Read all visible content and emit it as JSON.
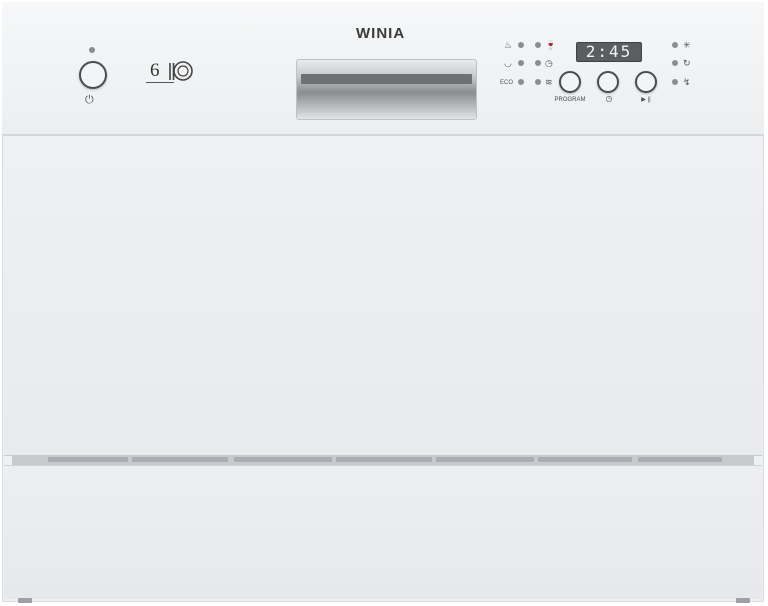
{
  "brand": {
    "name": "WINIA"
  },
  "power": {
    "icon": "power-icon",
    "symbol": "⏻"
  },
  "capacity": {
    "value": "6",
    "icon": "place-setting-icon"
  },
  "left_indicators": [
    {
      "icon": "pot-icon",
      "glyph": "♨"
    },
    {
      "icon": "bowl-icon",
      "glyph": "◡"
    },
    {
      "icon": "eco-label",
      "glyph": "ECO"
    }
  ],
  "mid_indicators": [
    {
      "icon": "wine-glass-icon",
      "glyph": "🍷"
    },
    {
      "icon": "quick-wash-icon",
      "glyph": "◷"
    },
    {
      "icon": "rinse-icon",
      "glyph": "≋"
    }
  ],
  "right_indicators": [
    {
      "icon": "sanitize-icon",
      "glyph": "✳"
    },
    {
      "icon": "refresh-icon",
      "glyph": "↻"
    },
    {
      "icon": "salt-icon",
      "glyph": "↯"
    }
  ],
  "display": {
    "time": "2:45"
  },
  "buttons": {
    "program": {
      "label": "PROGRAM"
    },
    "delay": {
      "label": "◷"
    },
    "start_pause": {
      "label": "▶ ||"
    }
  }
}
